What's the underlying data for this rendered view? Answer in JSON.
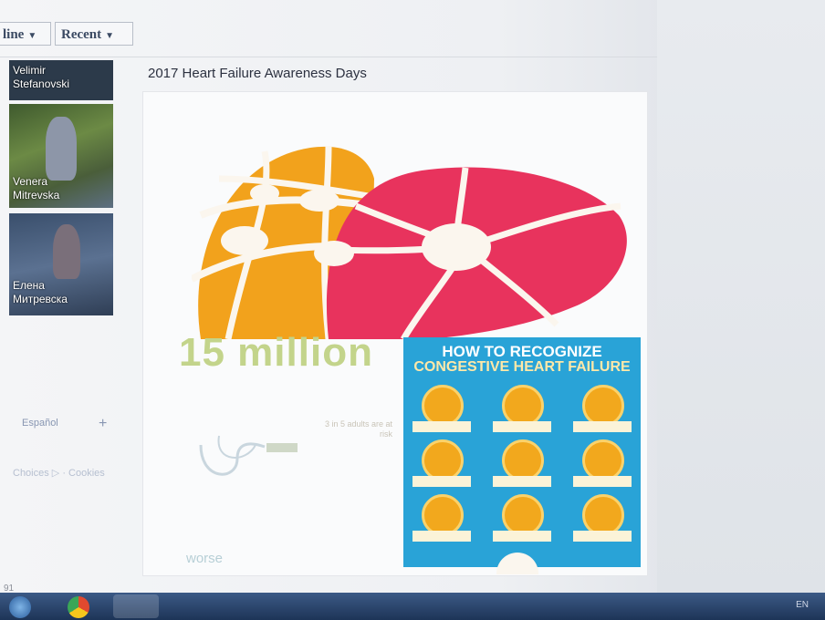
{
  "header": {
    "filter_timeline": "line",
    "filter_recent": "Recent"
  },
  "friends": [
    {
      "first": "Velimir",
      "last": "Stefanovski"
    },
    {
      "first": "Venera",
      "last": "Mitrevska"
    },
    {
      "first": "Елена",
      "last": "Митревска"
    }
  ],
  "sidebar": {
    "language": "Español",
    "add_language": "+",
    "footer_links": "Choices ▷ · Cookies"
  },
  "post": {
    "title": "2017 Heart Failure Awareness Days",
    "stat_big": "15 million",
    "stat_small": "3 in 5 adults are at risk",
    "worse_text": "worse",
    "recognize_line1": "HOW TO RECOGNIZE",
    "recognize_line2": "CONGESTIVE HEART FAILURE"
  },
  "status": {
    "bottom_left": "91",
    "tray": "EN"
  },
  "colors": {
    "heart_orange": "#f2a21c",
    "heart_pink": "#e8335d",
    "infographic_blue": "#29a3d7"
  }
}
